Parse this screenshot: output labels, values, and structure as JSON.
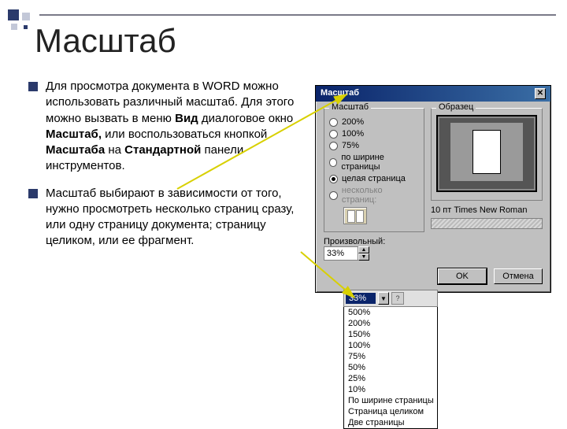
{
  "title": "Масштаб",
  "bullets": {
    "b1_pre": "Для просмотра документа в WORD можно использовать различный масштаб. Для этого можно вызвать в меню ",
    "b1_bold1": "Вид",
    "b1_mid": " диалоговое окно ",
    "b1_bold2": "Масштаб,",
    "b1_mid2": " или воспользоваться кнопкой ",
    "b1_bold3": "Масштаба",
    "b1_mid3": " на ",
    "b1_bold4": "Стандартной",
    "b1_end": " панели инструментов.",
    "b2": "Масштаб выбирают в зависимости от того, нужно просмотреть несколько страниц сразу, или одну страницу документа; страницу целиком, или ее фрагмент."
  },
  "dialog": {
    "title": "Масштаб",
    "legend_scale": "Масштаб",
    "legend_preview": "Образец",
    "opt_200": "200%",
    "opt_100": "100%",
    "opt_75": "75%",
    "opt_width": "по ширине страницы",
    "opt_whole": "целая страница",
    "opt_multi": "несколько страниц:",
    "spin_label": "Произвольный:",
    "spin_value": "33%",
    "preview_caption": "10 пт Times New Roman",
    "btn_ok": "OK",
    "btn_cancel": "Отмена"
  },
  "dropdown": {
    "selected": "33%",
    "items": [
      "500%",
      "200%",
      "150%",
      "100%",
      "75%",
      "50%",
      "25%",
      "10%",
      "По ширине страницы",
      "Страница целиком",
      "Две страницы"
    ]
  }
}
